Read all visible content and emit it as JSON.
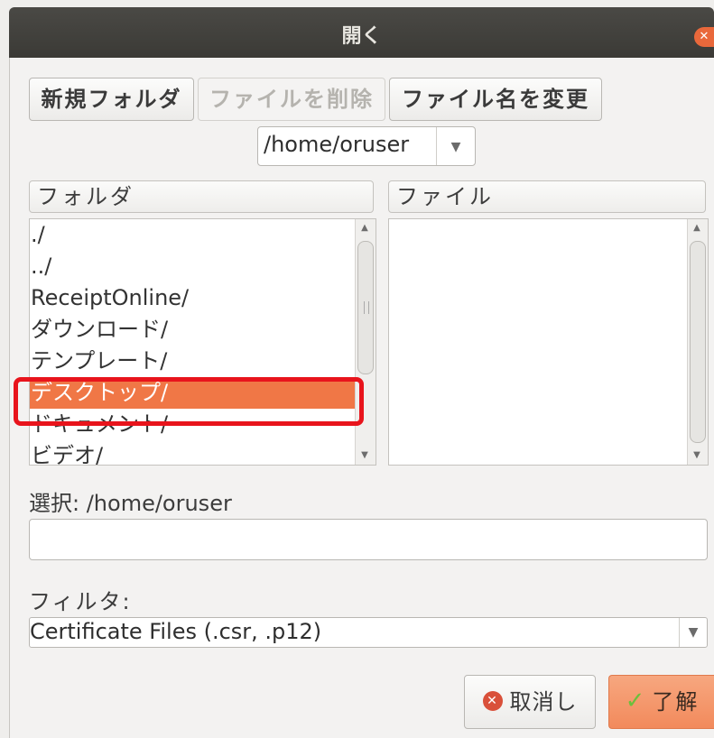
{
  "window": {
    "title": "開く"
  },
  "toolbar": {
    "new_folder": "新規フォルダ",
    "delete_file": "ファイルを削除",
    "rename_file": "ファイル名を変更"
  },
  "path_combo": {
    "value": "/home/oruser"
  },
  "folders": {
    "header": "フォルダ",
    "items": [
      {
        "label": "./"
      },
      {
        "label": "../"
      },
      {
        "label": "ReceiptOnline/"
      },
      {
        "label": "ダウンロード/"
      },
      {
        "label": "テンプレート/"
      },
      {
        "label": "デスクトップ/"
      },
      {
        "label": "ドキュメント/"
      },
      {
        "label": "ビデオ/"
      }
    ],
    "selected": "デスクトップ/"
  },
  "files": {
    "header": "ファイル",
    "items": []
  },
  "selection": {
    "label": "選択: /home/oruser",
    "value": ""
  },
  "filter": {
    "label": "フィルタ:",
    "value": "Certificate Files (.csr, .p12)"
  },
  "actions": {
    "cancel": "取消し",
    "ok": "了解"
  },
  "colors": {
    "accent": "#f07746",
    "highlight_border": "#e8141c",
    "titlebar": "#3b3a36"
  },
  "icons": {
    "close": "close-icon",
    "cancel": "cancel-icon",
    "ok": "checkmark-icon",
    "dropdown": "chevron-down-icon"
  }
}
